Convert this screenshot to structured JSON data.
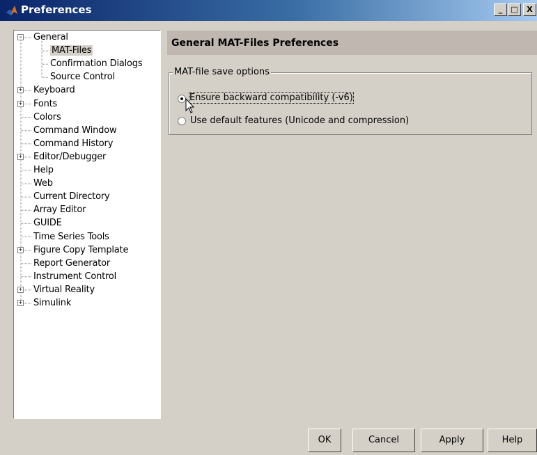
{
  "window": {
    "title": "Preferences",
    "minimize": "_",
    "maximize": "□",
    "close": "X"
  },
  "tree": {
    "items": [
      {
        "label": "General",
        "level": 0,
        "toggle": "−"
      },
      {
        "label": "MAT-Files",
        "level": 1,
        "selected": true
      },
      {
        "label": "Confirmation Dialogs",
        "level": 1
      },
      {
        "label": "Source Control",
        "level": 1
      },
      {
        "label": "Keyboard",
        "level": 0,
        "toggle": "+"
      },
      {
        "label": "Fonts",
        "level": 0,
        "toggle": "+"
      },
      {
        "label": "Colors",
        "level": 0
      },
      {
        "label": "Command Window",
        "level": 0
      },
      {
        "label": "Command History",
        "level": 0
      },
      {
        "label": "Editor/Debugger",
        "level": 0,
        "toggle": "+"
      },
      {
        "label": "Help",
        "level": 0
      },
      {
        "label": "Web",
        "level": 0
      },
      {
        "label": "Current Directory",
        "level": 0
      },
      {
        "label": "Array Editor",
        "level": 0
      },
      {
        "label": "GUIDE",
        "level": 0
      },
      {
        "label": "Time Series Tools",
        "level": 0
      },
      {
        "label": "Figure Copy Template",
        "level": 0,
        "toggle": "+"
      },
      {
        "label": "Report Generator",
        "level": 0
      },
      {
        "label": "Instrument Control",
        "level": 0
      },
      {
        "label": "Virtual Reality",
        "level": 0,
        "toggle": "+"
      },
      {
        "label": "Simulink",
        "level": 0,
        "toggle": "+"
      }
    ]
  },
  "panel": {
    "header": "General MAT-Files Preferences",
    "group_title": "MAT-file save options",
    "options": [
      {
        "label": "Ensure backward compatibility (-v6)",
        "selected": true
      },
      {
        "label": "Use default features (Unicode and compression)",
        "selected": false
      }
    ]
  },
  "buttons": {
    "ok": "OK",
    "cancel": "Cancel",
    "apply": "Apply",
    "help": "Help"
  }
}
